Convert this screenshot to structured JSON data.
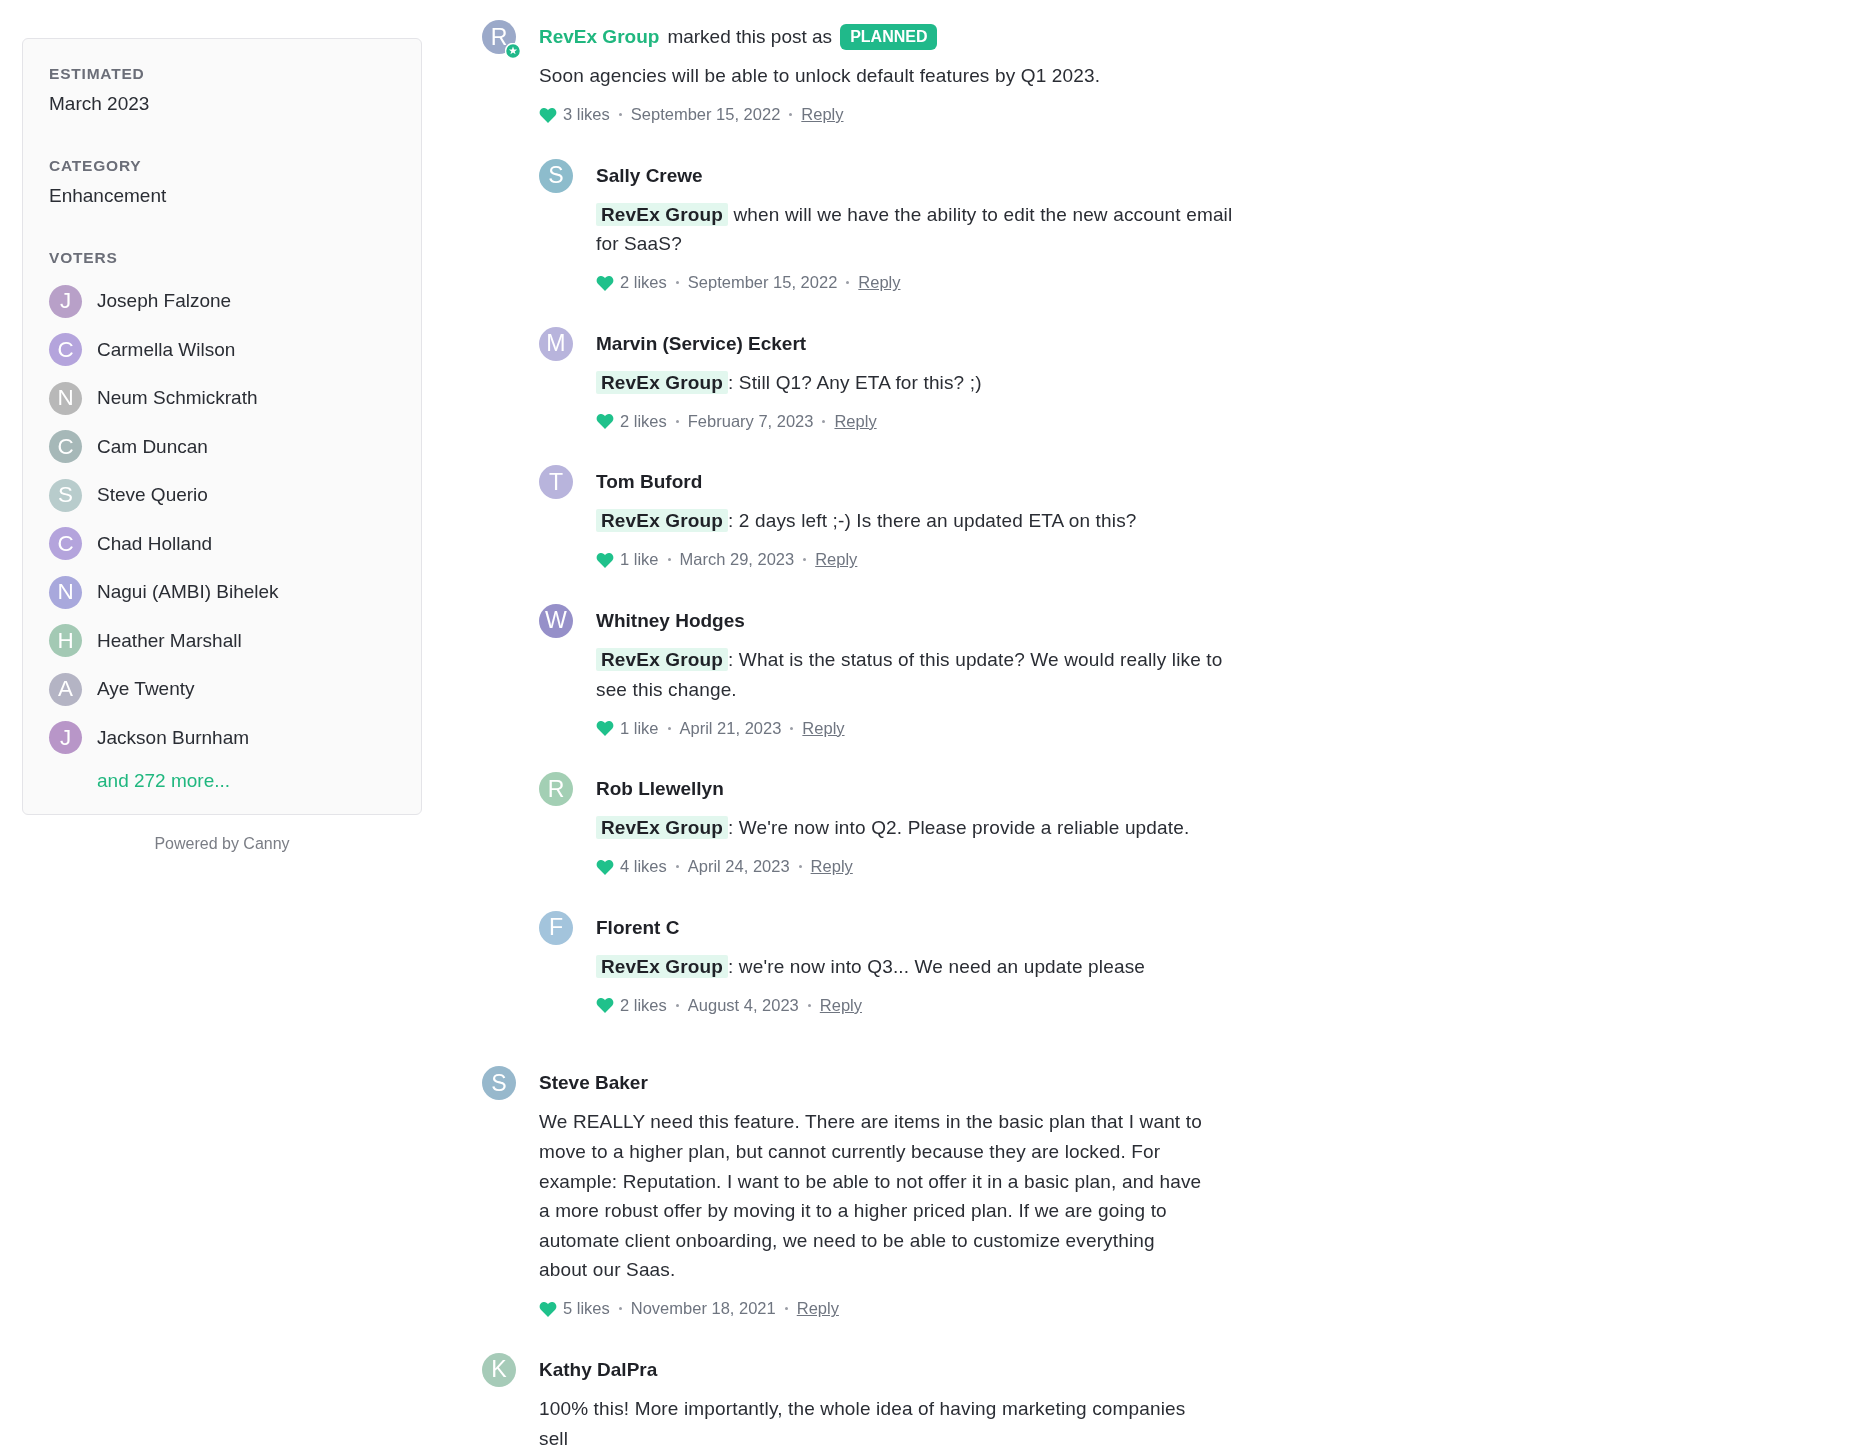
{
  "sidebar": {
    "sections": [
      {
        "heading": "ESTIMATED",
        "value": "March 2023"
      },
      {
        "heading": "CATEGORY",
        "value": "Enhancement"
      }
    ],
    "voters_heading": "VOTERS",
    "voters": [
      {
        "initial": "J",
        "name": "Joseph Falzone",
        "color": "#b8a0c8"
      },
      {
        "initial": "C",
        "name": "Carmella Wilson",
        "color": "#b4a4dc"
      },
      {
        "initial": "N",
        "name": "Neum Schmickrath",
        "color": "#b8b8b8"
      },
      {
        "initial": "C",
        "name": "Cam Duncan",
        "color": "#a6b8b8"
      },
      {
        "initial": "S",
        "name": "Steve Querio",
        "color": "#b8cccc"
      },
      {
        "initial": "C",
        "name": "Chad Holland",
        "color": "#b4a4dc"
      },
      {
        "initial": "N",
        "name": "Nagui (AMBI) Bihelek",
        "color": "#a8a8dc"
      },
      {
        "initial": "H",
        "name": "Heather Marshall",
        "color": "#a3c9b4"
      },
      {
        "initial": "A",
        "name": "Aye Twenty",
        "color": "#b4b4c4"
      },
      {
        "initial": "J",
        "name": "Jackson Burnham",
        "color": "#b896c8"
      }
    ],
    "more_link": "and 272 more..."
  },
  "powered_by": "Powered by Canny",
  "comments": [
    {
      "kind": "status_update",
      "initial": "R",
      "color": "#9ba9c9",
      "admin": true,
      "author": "RevEx Group",
      "action": "marked this post as",
      "status": "PLANNED",
      "body": {
        "text": "Soon agencies will be able to unlock default features by Q1 2023."
      },
      "meta": {
        "likes": "3 likes",
        "date": "September 15, 2022",
        "reply": "Reply"
      },
      "replies": [
        {
          "kind": "comment",
          "initial": "S",
          "color": "#8dbccc",
          "author": "Sally Crewe",
          "body": {
            "mention": "RevEx Group",
            "text": " when will we have the ability to edit the new account email for SaaS?"
          },
          "meta": {
            "likes": "2 likes",
            "date": "September 15, 2022",
            "reply": "Reply"
          }
        },
        {
          "kind": "comment",
          "initial": "M",
          "color": "#b8b4dc",
          "author": "Marvin (Service) Eckert",
          "body": {
            "mention": "RevEx Group",
            "text": ": Still Q1? Any ETA for this? ;)"
          },
          "meta": {
            "likes": "2 likes",
            "date": "February 7, 2023",
            "reply": "Reply"
          }
        },
        {
          "kind": "comment",
          "initial": "T",
          "color": "#b8b4dc",
          "author": "Tom Buford",
          "body": {
            "mention": "RevEx Group",
            "text": ": 2 days left ;-) Is there an updated ETA on this?"
          },
          "meta": {
            "likes": "1 like",
            "date": "March 29, 2023",
            "reply": "Reply"
          }
        },
        {
          "kind": "comment",
          "initial": "W",
          "color": "#9690c9",
          "author": "Whitney Hodges",
          "body": {
            "mention": "RevEx Group",
            "text": ": What is the status of this update? We would really like to see this change."
          },
          "meta": {
            "likes": "1 like",
            "date": "April 21, 2023",
            "reply": "Reply"
          }
        },
        {
          "kind": "comment",
          "initial": "R",
          "color": "#a3cfb4",
          "author": "Rob Llewellyn",
          "body": {
            "mention": "RevEx Group",
            "text": ": We're now into Q2. Please provide a reliable update."
          },
          "meta": {
            "likes": "4 likes",
            "date": "April 24, 2023",
            "reply": "Reply"
          }
        },
        {
          "kind": "comment",
          "initial": "F",
          "color": "#a3c4dc",
          "author": "Florent C",
          "body": {
            "mention": "RevEx Group",
            "text": ": we're now into Q3... We need an update please"
          },
          "meta": {
            "likes": "2 likes",
            "date": "August 4, 2023",
            "reply": "Reply"
          }
        }
      ]
    },
    {
      "kind": "comment",
      "initial": "S",
      "color": "#97b8cc",
      "author": "Steve Baker",
      "body": {
        "text": "We REALLY need this feature. There are items in the basic plan that I want to move to a higher plan, but cannot currently because they are locked. For example: Reputation. I want to be able to not offer it in a basic plan, and have a more robust offer by moving it to a higher priced plan. If we are going to automate client onboarding, we need to be able to customize everything about our Saas."
      },
      "meta": {
        "likes": "5 likes",
        "date": "November 18, 2021",
        "reply": "Reply"
      }
    },
    {
      "kind": "comment",
      "initial": "K",
      "color": "#a6cbb8",
      "author": "Kathy DalPra",
      "body": {
        "text": "100% this! More importantly, the whole idea of having marketing companies sell"
      }
    }
  ]
}
